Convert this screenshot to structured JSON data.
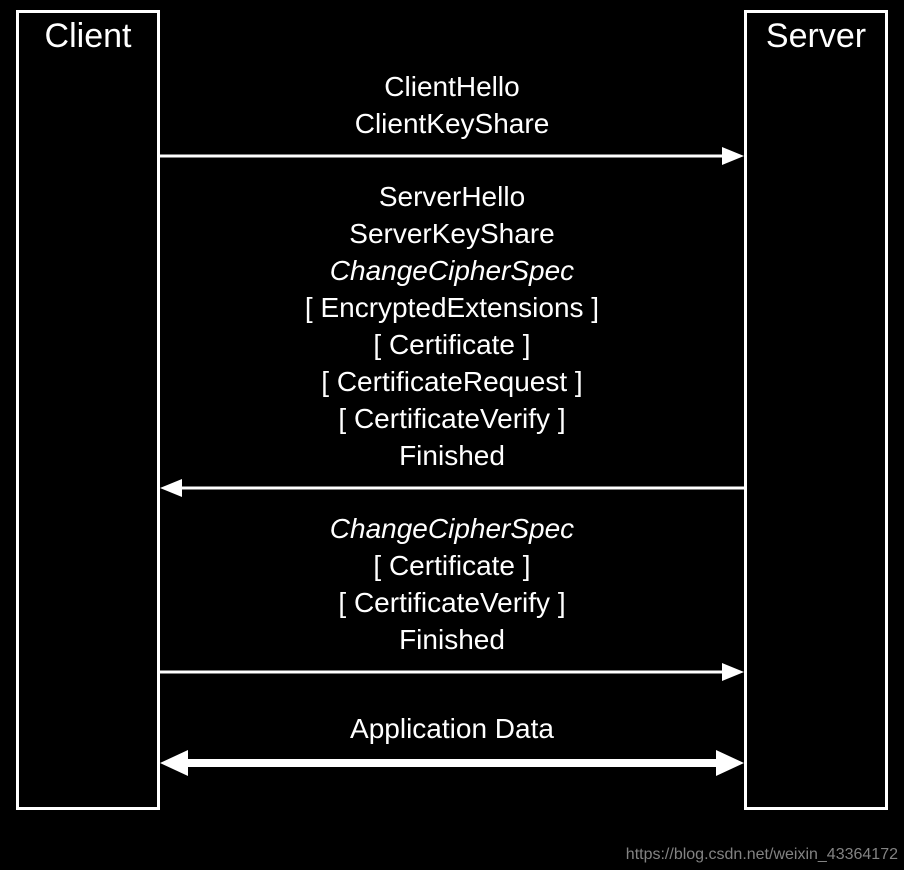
{
  "actors": {
    "client": "Client",
    "server": "Server"
  },
  "flights": [
    {
      "direction": "right",
      "lines": [
        {
          "text": "ClientHello",
          "italic": false
        },
        {
          "text": "ClientKeyShare",
          "italic": false
        }
      ]
    },
    {
      "direction": "left",
      "lines": [
        {
          "text": "ServerHello",
          "italic": false
        },
        {
          "text": "ServerKeyShare",
          "italic": false
        },
        {
          "text": "ChangeCipherSpec",
          "italic": true
        },
        {
          "text": "[ EncryptedExtensions ]",
          "italic": false
        },
        {
          "text": "[ Certificate ]",
          "italic": false
        },
        {
          "text": "[ CertificateRequest ]",
          "italic": false
        },
        {
          "text": "[ CertificateVerify ]",
          "italic": false
        },
        {
          "text": "Finished",
          "italic": false
        }
      ]
    },
    {
      "direction": "right",
      "lines": [
        {
          "text": "ChangeCipherSpec",
          "italic": true
        },
        {
          "text": "[ Certificate ]",
          "italic": false
        },
        {
          "text": "[ CertificateVerify ]",
          "italic": false
        },
        {
          "text": "Finished",
          "italic": false
        }
      ]
    },
    {
      "direction": "both",
      "lines": [
        {
          "text": "Application Data",
          "italic": false
        }
      ]
    }
  ],
  "watermark": "https://blog.csdn.net/weixin_43364172"
}
